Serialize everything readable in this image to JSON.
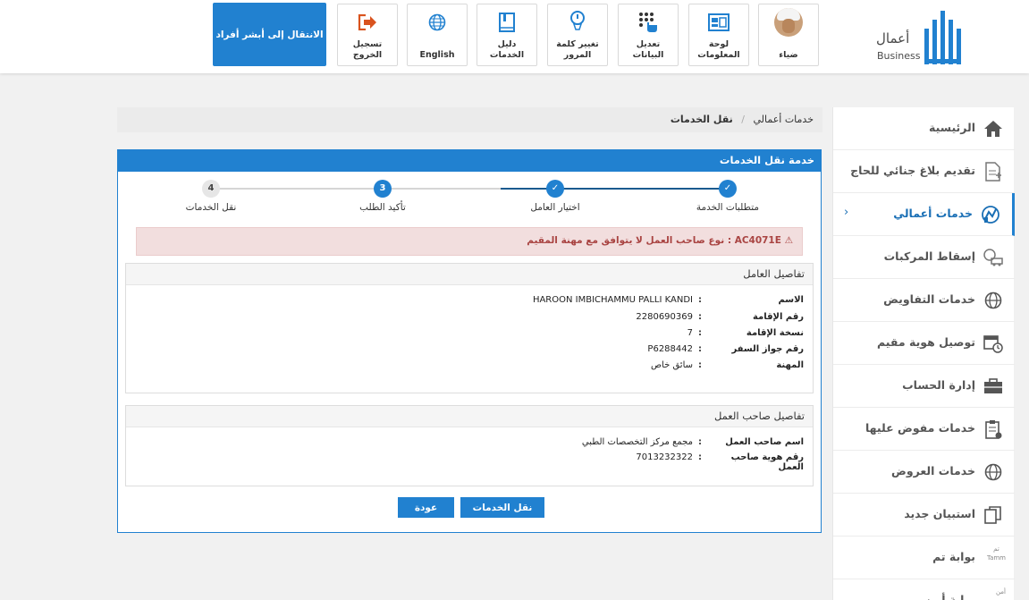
{
  "header": {
    "logo": {
      "brand_ar": "أعمال",
      "brand_en": "Business"
    },
    "tiles": [
      {
        "label": "ضياء",
        "icon": "user-avatar"
      },
      {
        "label": "لوحة المعلومات",
        "icon": "dashboard-icon"
      },
      {
        "label": "تعديل البيانات",
        "icon": "touch-edit-icon"
      },
      {
        "label": "تغيير كلمة المرور",
        "icon": "password-icon"
      },
      {
        "label": "دليل الخدمات",
        "icon": "book-icon"
      },
      {
        "label": "English",
        "icon": "globe-icon"
      },
      {
        "label": "تسجيل الخروج",
        "icon": "logout-icon"
      }
    ],
    "absher_button": "الانتقال إلى أبشر أفراد"
  },
  "sidebar": {
    "items": [
      {
        "label": "الرئيسية",
        "icon": "home-icon"
      },
      {
        "label": "تقديم بلاغ جنائي للحاج",
        "icon": "report-icon"
      },
      {
        "label": "خدمات أعمالي",
        "icon": "business-services-icon",
        "chevron": "‹"
      },
      {
        "label": "إسقاط المركبات",
        "icon": "vehicle-icon"
      },
      {
        "label": "خدمات التفاويض",
        "icon": "globe-icon"
      },
      {
        "label": "توصيل هوية مقيم",
        "icon": "calendar-clock-icon"
      },
      {
        "label": "إدارة الحساب",
        "icon": "briefcase-icon"
      },
      {
        "label": "خدمات مفوض عليها",
        "icon": "clipboard-icon"
      },
      {
        "label": "خدمات العروض",
        "icon": "globe-icon"
      },
      {
        "label": "استبيان جديد",
        "icon": "copy-icon"
      },
      {
        "label": "بوابة تم",
        "icon": "tamm-icon",
        "tiny_top": "تم",
        "tiny_bottom": "Tamm"
      },
      {
        "label": "بوابة أمن",
        "icon": "amn-icon",
        "tiny_top": "أمن"
      }
    ]
  },
  "breadcrumb": {
    "parent": "خدمات أعمالي",
    "separator": "/",
    "current": "نقل الخدمات"
  },
  "panel": {
    "title": "خدمة نقل الخدمات",
    "steps": [
      {
        "label": "متطلبات الخدمة",
        "state": "done",
        "mark": "✓"
      },
      {
        "label": "اختيار العامل",
        "state": "done",
        "mark": "✓"
      },
      {
        "label": "تأكيد الطلب",
        "state": "current",
        "mark": "3"
      },
      {
        "label": "نقل الخدمات",
        "state": "pending",
        "mark": "4"
      }
    ],
    "alert": {
      "code": "AC4071E",
      "message": ": نوع صاحب العمل لا يتوافق مع مهنة المقيم"
    },
    "worker": {
      "title": "تفاصيل العامل",
      "rows": [
        {
          "key": "الاسم",
          "value": "HAROON IMBICHAMMU PALLI KANDI"
        },
        {
          "key": "رقم الإقامة",
          "value": "2280690369"
        },
        {
          "key": "نسخة الإقامة",
          "value": "7"
        },
        {
          "key": "رقم جواز السفر",
          "value": "P6288442"
        },
        {
          "key": "المهنة",
          "value": "سائق خاص"
        }
      ]
    },
    "employer": {
      "title": "تفاصيل صاحب العمل",
      "rows": [
        {
          "key": "اسم صاحب العمل",
          "value": "مجمع مركز التخصصات الطبي"
        },
        {
          "key": "رقم هوية صاحب العمل",
          "value": "7013232322"
        }
      ]
    },
    "colon": ":",
    "buttons": {
      "transfer": "نقل الخدمات",
      "back": "عودة"
    }
  },
  "colors": {
    "primary": "#2181d0",
    "alert_bg": "#f2dede",
    "alert_text": "#a94442",
    "sidebar_active": "#1a6fb5"
  }
}
